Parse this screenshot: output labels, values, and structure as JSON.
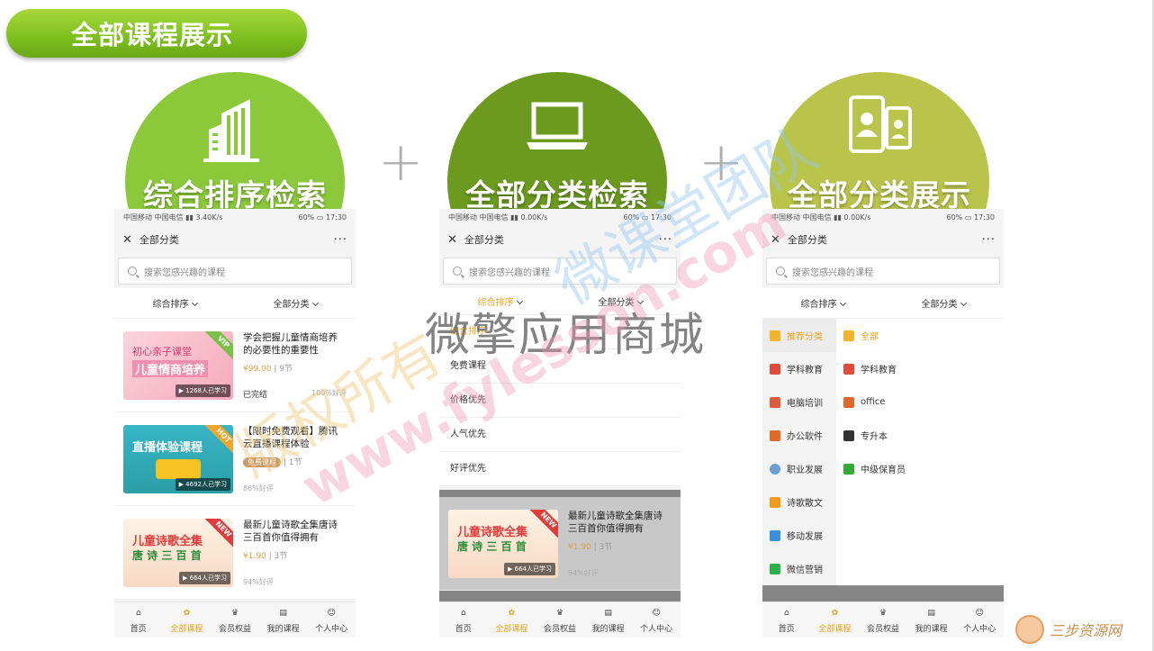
{
  "slide": {
    "title": "全部课程展示"
  },
  "colors": {
    "green1": "#8bc93a",
    "green2": "#6b9a1e",
    "green3": "#b9c44a",
    "accent": "#e8a31f",
    "price": "#d9a24a"
  },
  "circles": [
    {
      "title": "综合排序检索",
      "icon": "building-icon"
    },
    {
      "title": "全部分类检索",
      "icon": "laptop-icon"
    },
    {
      "title": "全部分类展示",
      "icon": "phones-icon"
    }
  ],
  "phones": [
    {
      "carrier": "中国移动 中国电信",
      "speed": "3.40K/s",
      "battery": "60%",
      "time": "17:30"
    },
    {
      "carrier": "中国移动 中国电信",
      "speed": "0.00K/s",
      "battery": "60%",
      "time": "17:30"
    },
    {
      "carrier": "中国移动 中国电信",
      "speed": "0.00K/s",
      "battery": "60%",
      "time": "17:30"
    }
  ],
  "common": {
    "nav_title": "全部分类",
    "search_placeholder": "搜索您感兴趣的课程",
    "filter_sort": "综合排序",
    "filter_category": "全部分类"
  },
  "courses": [
    {
      "title": "学会把握儿童情商培养的必要性的重要性",
      "price": "¥99.00",
      "lessons": "9节",
      "learners": "1268人已学习",
      "status": "已完结",
      "rating": "100%好评",
      "thumb_text1": "初心亲子课堂",
      "thumb_text2": "儿童情商培养",
      "corner": "VIP"
    },
    {
      "title": "【限时免费观看】腾讯云直播课程体验",
      "badge": "免费课程",
      "lessons": "1节",
      "learners": "4692人已学习",
      "rating": "86%好评",
      "thumb_text1": "直播体验课程",
      "corner": "HOT"
    },
    {
      "title": "最新儿童诗歌全集唐诗三百首你值得拥有",
      "price": "¥1.90",
      "lessons": "3节",
      "learners": "664人已学习",
      "rating": "94%好评",
      "thumb_text1": "儿童诗歌全集",
      "thumb_text2": "唐 诗 三 百 首",
      "corner": "NEW"
    }
  ],
  "sort_options": [
    "综合排序",
    "免费课程",
    "价格优先",
    "人气优先",
    "好评优先"
  ],
  "category_left": [
    "推荐分类",
    "学科教育",
    "电脑培训",
    "办公软件",
    "职业发展",
    "诗歌散文",
    "移动发展",
    "微信营销"
  ],
  "category_right": [
    "全部",
    "学科教育",
    "office",
    "专升本",
    "中级保育员"
  ],
  "tabs": [
    "首页",
    "全部课程",
    "会员权益",
    "我的课程",
    "个人中心"
  ],
  "watermarks": {
    "center": "微擎应用商城",
    "diag1": "版权所有",
    "diag2": "微课堂团队",
    "url": "www.fylesson.com"
  },
  "corner_logo": "三步资源网"
}
